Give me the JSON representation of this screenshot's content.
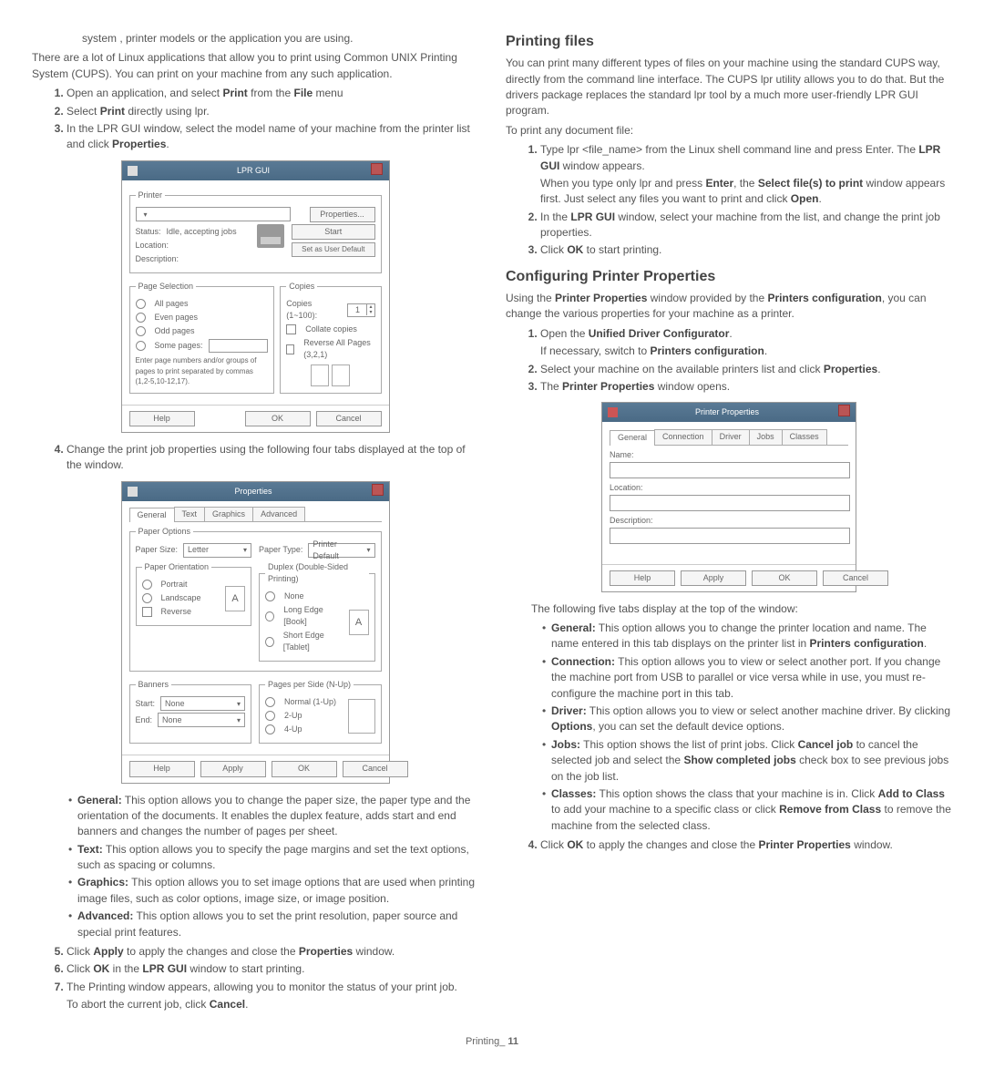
{
  "leftCol": {
    "intro1": "system , printer models or the application you are using.",
    "intro2": "There are a lot of Linux applications that allow you to print using Common UNIX Printing System (CUPS). You can print on your machine from any such application.",
    "step1_a": "Open an application, and select ",
    "step1_print": "Print",
    "step1_b": " from the ",
    "step1_file": "File",
    "step1_c": " menu",
    "step2_a": "Select ",
    "step2_print": "Print",
    "step2_b": " directly using lpr.",
    "step3_a": "In the LPR GUI window, select the model name of your machine from the printer list and click ",
    "step3_props": "Properties",
    "step3_b": ".",
    "step4": "Change the print job properties using the following four tabs displayed at the top of the window.",
    "bullet_general_h": "General:",
    "bullet_general": "  This option allows you to change the paper size, the paper type and the orientation of the documents. It enables the duplex feature, adds start and end banners and changes the number of pages per sheet.",
    "bullet_text_h": "Text:",
    "bullet_text": "  This option allows you to specify the page margins and set the text options, such as spacing or columns.",
    "bullet_graphics_h": "Graphics:",
    "bullet_graphics": "  This option allows you to set image options that are used when printing image files, such as color options, image size, or image position.",
    "bullet_advanced_h": "Advanced:",
    "bullet_advanced": "  This option allows you to set the print resolution, paper source and special print features.",
    "step5_a": "Click ",
    "step5_apply": "Apply",
    "step5_b": " to apply the changes and close the ",
    "step5_props": "Properties",
    "step5_c": " window.",
    "step6_a": "Click ",
    "step6_ok": "OK",
    "step6_b": " in the ",
    "step6_lpr": "LPR GUI",
    "step6_c": " window to start printing.",
    "step7": "The Printing window appears, allowing you to monitor the status of your print job.",
    "step7_sub_a": "To abort the current job, click ",
    "step7_cancel": "Cancel",
    "step7_sub_b": "."
  },
  "lprWin": {
    "title": "LPR GUI",
    "printer_legend": "Printer",
    "status_lbl": "Status:",
    "status_val": "Idle, accepting jobs",
    "location_lbl": "Location:",
    "description_lbl": "Description:",
    "btn_properties": "Properties...",
    "btn_start": "Start",
    "btn_setdefault": "Set as User Default",
    "pagesel_legend": "Page Selection",
    "allpages": "All pages",
    "evenpages": "Even pages",
    "oddpages": "Odd pages",
    "somepages": "Some pages:",
    "pagenote": "Enter page numbers and/or groups of pages to print separated by commas (1,2-5,10-12,17).",
    "copies_legend": "Copies",
    "copies_lbl": "Copies (1~100):",
    "copies_val": "1",
    "collate": "Collate copies",
    "reverse": "Reverse All Pages (3,2,1)",
    "help": "Help",
    "ok": "OK",
    "cancel": "Cancel"
  },
  "propsWin": {
    "title": "Properties",
    "tab_general": "General",
    "tab_text": "Text",
    "tab_graphics": "Graphics",
    "tab_advanced": "Advanced",
    "paperopts": "Paper Options",
    "papersize_lbl": "Paper Size:",
    "papersize_val": "Letter",
    "papertype_lbl": "Paper Type:",
    "papertype_val": "Printer Default",
    "orientation": "Paper Orientation",
    "portrait": "Portrait",
    "landscape": "Landscape",
    "reverse": "Reverse",
    "duplex": "Duplex (Double-Sided Printing)",
    "none": "None",
    "longedge": "Long Edge [Book]",
    "shortedge": "Short Edge [Tablet]",
    "banners": "Banners",
    "start_lbl": "Start:",
    "start_val": "None",
    "end_lbl": "End:",
    "end_val": "None",
    "nup": "Pages per Side (N-Up)",
    "normal": "Normal (1-Up)",
    "up2": "2-Up",
    "up4": "4-Up",
    "help": "Help",
    "apply": "Apply",
    "ok": "OK",
    "cancel": "Cancel"
  },
  "rightCol": {
    "h_print": "Printing files",
    "print_intro": "You can print many different types of files on your machine using the standard CUPS way, directly from the command line interface. The CUPS lpr utility allows you to do that. But the drivers package replaces the standard lpr tool by a much more user-friendly LPR GUI program.",
    "print_any": "To print any document file:",
    "pstep1_a": "Type lpr <file_name> from the Linux shell command line and press Enter. The ",
    "pstep1_lpr": "LPR GUI",
    "pstep1_b": " window appears.",
    "pstep1_sub_a": "When you type only lpr and press ",
    "pstep1_enter": "Enter",
    "pstep1_sub_b": ", the ",
    "pstep1_select": "Select file(s) to print",
    "pstep1_sub_c": " window appears first. Just select any files you want to print and click ",
    "pstep1_open": "Open",
    "pstep1_sub_d": ".",
    "pstep2_a": "In the ",
    "pstep2_lpr": "LPR GUI",
    "pstep2_b": " window, select your machine from the list, and change the print job properties.",
    "pstep3_a": "Click ",
    "pstep3_ok": "OK",
    "pstep3_b": " to start printing.",
    "h_config": "Configuring Printer Properties",
    "config_intro_a": "Using the ",
    "config_pp": "Printer Properties",
    "config_intro_b": " window provided by the ",
    "config_pc": "Printers configuration",
    "config_intro_c": ", you can change the various properties for your machine as a printer.",
    "cstep1_a": "Open the ",
    "cstep1_udc": "Unified Driver Configurator",
    "cstep1_b": ".",
    "cstep1_sub_a": "If necessary, switch to ",
    "cstep1_pc": "Printers configuration",
    "cstep1_sub_b": ".",
    "cstep2_a": "Select your machine on the available printers list and click ",
    "cstep2_props": "Properties",
    "cstep2_b": ".",
    "cstep3_a": "The ",
    "cstep3_pp": "Printer Properties",
    "cstep3_b": " window opens.",
    "tabs_intro": "The following five tabs display at the top of the window:",
    "t_general_h": "General:",
    "t_general_a": "  This option allows you to change the printer location and name. The name entered in this tab displays on the printer list in ",
    "t_general_pc": "Printers configuration",
    "t_general_b": ".",
    "t_conn_h": "Connection:",
    "t_conn": "  This option allows you to view or select another port. If you change the machine port from USB to parallel or vice versa while in use, you must re-configure the machine port in this tab.",
    "t_driver_h": "Driver:",
    "t_driver_a": "  This option allows you to view or select another machine driver. By clicking ",
    "t_driver_opts": "Options",
    "t_driver_b": ", you can set the default device options.",
    "t_jobs_h": "Jobs:",
    "t_jobs_a": "  This option shows the list of print jobs. Click ",
    "t_jobs_cj": "Cancel job",
    "t_jobs_b": " to cancel the selected job and select the ",
    "t_jobs_scj": "Show completed jobs",
    "t_jobs_c": " check box to see previous jobs on the job list.",
    "t_classes_h": "Classes:",
    "t_classes_a": "  This option shows the class that your machine is in. Click ",
    "t_classes_add": "Add to Class",
    "t_classes_b": " to add your machine to a specific class or click ",
    "t_classes_rem": "Remove from Class",
    "t_classes_c": " to remove the machine from the selected class.",
    "cstep4_a": "Click ",
    "cstep4_ok": "OK",
    "cstep4_b": " to apply the changes and close the ",
    "cstep4_pp": "Printer Properties",
    "cstep4_c": " window."
  },
  "ppWin": {
    "title": "Printer Properties",
    "tab_general": "General",
    "tab_connection": "Connection",
    "tab_driver": "Driver",
    "tab_jobs": "Jobs",
    "tab_classes": "Classes",
    "name": "Name:",
    "location": "Location:",
    "description": "Description:",
    "help": "Help",
    "apply": "Apply",
    "ok": "OK",
    "cancel": "Cancel"
  },
  "footer": {
    "label": "Printing_",
    "page": "11"
  }
}
